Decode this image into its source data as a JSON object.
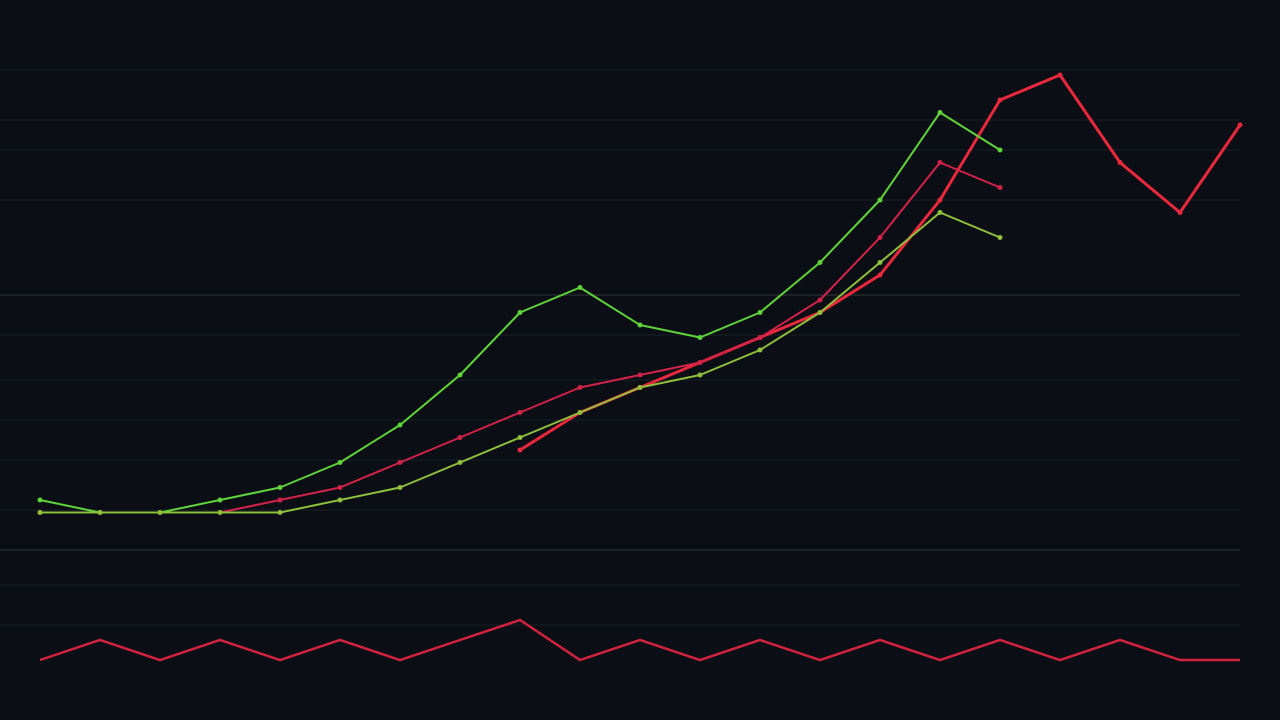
{
  "header": {
    "title": ""
  },
  "chart_data": {
    "type": "line",
    "title": "",
    "xlabel": "",
    "ylabel": "",
    "grid": true,
    "legend": "none",
    "x_index": [
      0,
      1,
      2,
      3,
      4,
      5,
      6,
      7,
      8,
      9,
      10,
      11,
      12,
      13,
      14,
      15,
      16,
      17,
      18,
      19,
      20
    ],
    "series": [
      {
        "color": "#e8283c",
        "values": [
          null,
          null,
          null,
          null,
          null,
          null,
          null,
          null,
          8,
          11,
          13,
          15,
          17,
          19,
          22,
          28,
          36,
          38,
          31,
          27,
          34
        ]
      },
      {
        "color": "#5fd33a",
        "values": [
          4,
          3,
          3,
          4,
          5,
          7,
          10,
          14,
          19,
          21,
          18,
          17,
          19,
          23,
          28,
          35,
          32,
          null,
          null,
          null,
          null
        ]
      },
      {
        "color": "#d1234a",
        "values": [
          3,
          3,
          3,
          3,
          4,
          5,
          7,
          9,
          11,
          13,
          14,
          15,
          17,
          20,
          25,
          31,
          29,
          null,
          null,
          null,
          null
        ]
      },
      {
        "color": "#8fbf3b",
        "values": [
          3,
          3,
          3,
          3,
          3,
          4,
          5,
          7,
          9,
          11,
          13,
          14,
          16,
          19,
          23,
          27,
          25,
          null,
          null,
          null,
          null
        ]
      }
    ],
    "lower_panel": {
      "color": "#d1233f",
      "values": [
        2,
        3,
        2,
        3,
        2,
        3,
        2,
        3,
        4,
        2,
        3,
        2,
        3,
        2,
        3,
        2,
        3,
        2,
        3,
        2,
        2
      ]
    },
    "colors": {
      "background": "#0b0e15",
      "grid": "#2a2e36",
      "up": "#5fd33a",
      "down": "#e8283c"
    }
  }
}
